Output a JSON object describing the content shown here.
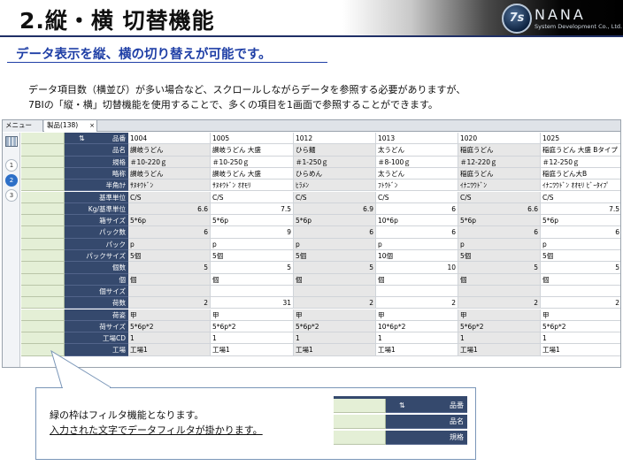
{
  "header": {
    "title": "2.縦・横 切替機能",
    "logo_mark": "7s",
    "logo_name": "NANA",
    "logo_sub": "System Development Co., Ltd."
  },
  "subtitle": "データ表示を縦、横の切り替えが可能です。",
  "description": [
    "データ項目数（横並び）が多い場合など、スクロールしながらデータを参照する必要がありますが、",
    "7BIの「縦・横」切替機能を使用することで、多くの項目を1画面で参照することができます。"
  ],
  "app": {
    "tabs": [
      {
        "label": "メニュー"
      },
      {
        "label": "製品(138)",
        "close": "×"
      }
    ],
    "pages": [
      "1",
      "2",
      "3"
    ],
    "active_page": "2",
    "sort_icon": "sort-az-icon",
    "fields": [
      "品番",
      "品名",
      "規格",
      "略称",
      "半角ｶﾅ",
      "基準単位",
      "Kg/基準単位",
      "箱サイズ",
      "パック数",
      "パック",
      "パックサイズ",
      "個数",
      "個",
      "個サイズ",
      "荷数",
      "荷姿",
      "荷サイズ",
      "工場CD",
      "工場"
    ],
    "records": [
      [
        "1004",
        "讃岐うどん",
        "＃10-220ｇ",
        "讃岐うどん",
        "ｻﾇｷｳﾄﾞﾝ",
        "C/S",
        "6.6",
        "5*6p",
        "6",
        "p",
        "5個",
        "5",
        "個",
        "",
        "2",
        "甲",
        "5*6p*2",
        "1",
        "工場1"
      ],
      [
        "1005",
        "讃岐うどん 大盛",
        "＃10-250ｇ",
        "讃岐うどん 大盛",
        "ｻﾇｷｳﾄﾞﾝ ｵｵﾓﾘ",
        "C/S",
        "7.5",
        "5*6p",
        "9",
        "p",
        "5個",
        "5",
        "個",
        "",
        "31",
        "甲",
        "5*6p*2",
        "1",
        "工場1"
      ],
      [
        "1012",
        "ひら麺",
        "＃1-250ｇ",
        "ひらめん",
        "ﾋﾗﾒﾝ",
        "C/S",
        "6.9",
        "5*6p",
        "6",
        "p",
        "5個",
        "5",
        "個",
        "",
        "2",
        "甲",
        "5*6p*2",
        "1",
        "工場1"
      ],
      [
        "1013",
        "太うどん",
        "＃8-100ｇ",
        "太うどん",
        "ﾌﾄｳﾄﾞﾝ",
        "C/S",
        "6",
        "10*6p",
        "6",
        "p",
        "10個",
        "10",
        "個",
        "",
        "2",
        "甲",
        "10*6p*2",
        "1",
        "工場1"
      ],
      [
        "1020",
        "稲庭うどん",
        "＃12-220ｇ",
        "稲庭うどん",
        "ｲﾅﾆﾜｳﾄﾞﾝ",
        "C/S",
        "6.6",
        "5*6p",
        "6",
        "p",
        "5個",
        "5",
        "個",
        "",
        "2",
        "甲",
        "5*6p*2",
        "1",
        "工場1"
      ],
      [
        "1025",
        "稲庭うどん 大盛 Bタイプ",
        "＃12-250ｇ",
        "稲庭うどん大B",
        "ｲﾅﾆﾜｳﾄﾞﾝ ｵｵﾓﾘ ﾋﾞｰﾀｲﾌﾟ",
        "C/S",
        "7.5",
        "5*6p",
        "6",
        "p",
        "5個",
        "5",
        "個",
        "",
        "2",
        "甲",
        "5*6p*2",
        "1",
        "工場1"
      ]
    ]
  },
  "callout": {
    "line1": "緑の枠はフィルタ機能となります。",
    "line2": "入力された文字でデータフィルタが掛かります。",
    "mini_fields": [
      "品番",
      "品名",
      "規格"
    ]
  },
  "colors": {
    "label_bg": "#35496d",
    "filter_bg": "#e4efd6",
    "subtitle": "#1f3fa6",
    "header_rule": "#1f2f66"
  }
}
